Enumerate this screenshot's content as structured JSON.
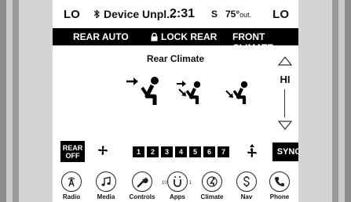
{
  "status": {
    "left_temp": "LO",
    "device": "Device Unpl...",
    "time": "2:31",
    "signal": "S",
    "outside_temp": "75°",
    "outside_unit": "out.",
    "right_temp": "LO"
  },
  "tabs": [
    {
      "label": "REAR AUTO"
    },
    {
      "label": "LOCK REAR"
    },
    {
      "label": "FRONT CLIMATE"
    }
  ],
  "climate": {
    "title": "Rear Climate",
    "temp_setting": "HI",
    "rear_off_line1": "REAR",
    "rear_off_line2": "OFF",
    "fan_levels": [
      "1",
      "2",
      "3",
      "4",
      "5",
      "6",
      "7"
    ],
    "sync_label": "SYNC"
  },
  "nav": {
    "items": [
      {
        "label": "Radio"
      },
      {
        "label": "Media"
      },
      {
        "label": "Controls"
      },
      {
        "label": "Apps"
      },
      {
        "label": "Climate"
      },
      {
        "label": "Nav"
      },
      {
        "label": "Phone"
      }
    ],
    "apps_badge_left": "10",
    "apps_badge_right": "1"
  }
}
